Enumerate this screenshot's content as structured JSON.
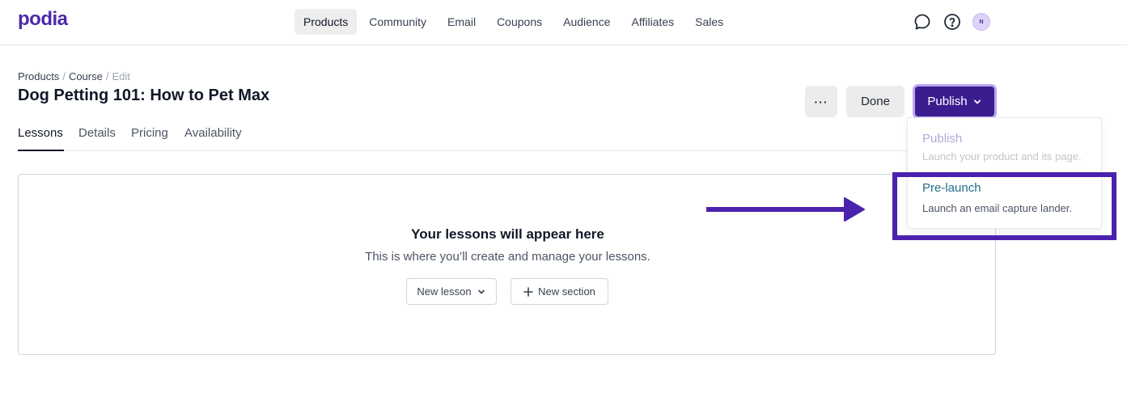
{
  "app": {
    "logo": "podia",
    "avatar_initial": "N"
  },
  "nav": {
    "items": [
      {
        "label": "Products",
        "active": true
      },
      {
        "label": "Community"
      },
      {
        "label": "Email"
      },
      {
        "label": "Coupons"
      },
      {
        "label": "Audience"
      },
      {
        "label": "Affiliates"
      },
      {
        "label": "Sales"
      }
    ],
    "icons": [
      "chat-icon",
      "help-icon"
    ]
  },
  "breadcrumb": {
    "products": "Products",
    "course": "Course",
    "edit": "Edit",
    "separator": "/"
  },
  "page": {
    "title": "Dog Petting 101: How to Pet Max"
  },
  "actions": {
    "more": "···",
    "done": "Done",
    "publish": "Publish"
  },
  "tabs": [
    {
      "label": "Lessons",
      "active": true
    },
    {
      "label": "Details"
    },
    {
      "label": "Pricing"
    },
    {
      "label": "Availability"
    }
  ],
  "empty_state": {
    "title": "Your lessons will appear here",
    "subtitle": "This is where you’ll create and manage your lessons.",
    "new_lesson": "New lesson",
    "new_section": "New section"
  },
  "publish_menu": {
    "items": [
      {
        "title": "Publish",
        "description": "Launch your product and its page.",
        "disabled": true
      },
      {
        "title": "Pre-launch",
        "description": "Launch an email capture lander.",
        "disabled": false
      }
    ]
  },
  "colors": {
    "brand": "#4c2aa8",
    "publish_button": "#3b1d8f",
    "annotation": "#4b22ae",
    "prelaunch_text": "#1f6f8b"
  }
}
